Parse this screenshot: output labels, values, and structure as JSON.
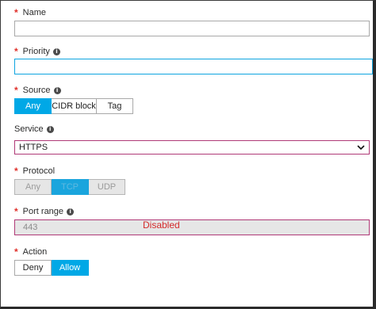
{
  "name": {
    "label": "Name",
    "value": ""
  },
  "priority": {
    "label": "Priority",
    "value": ""
  },
  "source": {
    "label": "Source",
    "options": [
      "Any",
      "CIDR block",
      "Tag"
    ],
    "selected": "Any"
  },
  "service": {
    "label": "Service",
    "value": "HTTPS"
  },
  "protocol": {
    "label": "Protocol",
    "options": [
      "Any",
      "TCP",
      "UDP"
    ],
    "selected": "TCP",
    "disabled": true
  },
  "port_range": {
    "label": "Port range",
    "value": "443",
    "annotation": "Disabled"
  },
  "action": {
    "label": "Action",
    "options": [
      "Deny",
      "Allow"
    ],
    "selected": "Allow"
  },
  "colors": {
    "accent": "#00a8e6",
    "required": "#e0302a",
    "annotation": "#d42a2a",
    "focus_border": "#0ea5e0",
    "error_border": "#b03a77"
  }
}
